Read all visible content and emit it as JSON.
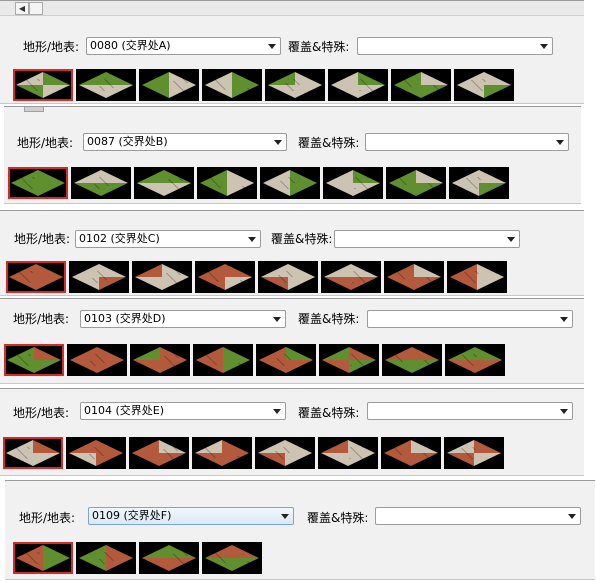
{
  "labels": {
    "terrain": "地形/地表:",
    "overlay": "覆盖&特殊:"
  },
  "colors": {
    "grass": "#5f8f2e",
    "stone": "#cdc3b3",
    "brick": "#b35a3c",
    "selected_border": "#d32a2a"
  },
  "panels": [
    {
      "terrain_value": "0080 (交界处A)",
      "overlay_value": "",
      "tiles": [
        {
          "icon": "transition-tile-icon",
          "left": "stone",
          "right": "stone",
          "top": "grass",
          "bottom": "grass",
          "selected": true
        },
        {
          "icon": "transition-tile-icon",
          "left": "grass",
          "right": "stone",
          "top": "grass",
          "bottom": "stone"
        },
        {
          "icon": "transition-tile-icon",
          "left": "grass",
          "right": "stone",
          "top": "stone",
          "bottom": "grass"
        },
        {
          "icon": "transition-tile-icon",
          "left": "stone",
          "right": "grass",
          "top": "grass",
          "bottom": "stone"
        },
        {
          "icon": "transition-tile-icon",
          "left": "grass",
          "right": "stone",
          "top": "stone",
          "bottom": "stone"
        },
        {
          "icon": "transition-tile-icon",
          "left": "stone",
          "right": "stone",
          "top": "grass",
          "bottom": "stone"
        },
        {
          "icon": "transition-tile-icon",
          "left": "grass",
          "right": "grass",
          "top": "stone",
          "bottom": "grass"
        },
        {
          "icon": "transition-tile-icon",
          "left": "stone",
          "right": "grass",
          "top": "stone",
          "bottom": "stone"
        }
      ]
    },
    {
      "terrain_value": "0087 (交界处B)",
      "overlay_value": "",
      "tiles": [
        {
          "icon": "transition-tile-icon",
          "left": "grass",
          "right": "grass",
          "top": "grass",
          "bottom": "grass",
          "selected": true
        },
        {
          "icon": "transition-tile-icon",
          "left": "stone",
          "right": "grass",
          "top": "stone",
          "bottom": "grass"
        },
        {
          "icon": "transition-tile-icon",
          "left": "grass",
          "right": "stone",
          "top": "grass",
          "bottom": "stone"
        },
        {
          "icon": "transition-tile-icon",
          "left": "grass",
          "right": "stone",
          "top": "stone",
          "bottom": "grass"
        },
        {
          "icon": "transition-tile-icon",
          "left": "stone",
          "right": "grass",
          "top": "grass",
          "bottom": "stone"
        },
        {
          "icon": "transition-tile-icon",
          "left": "stone",
          "right": "stone",
          "top": "grass",
          "bottom": "stone"
        },
        {
          "icon": "transition-tile-icon",
          "left": "grass",
          "right": "grass",
          "top": "stone",
          "bottom": "grass"
        },
        {
          "icon": "transition-tile-icon",
          "left": "stone",
          "right": "grass",
          "top": "stone",
          "bottom": "stone"
        }
      ]
    },
    {
      "terrain_value": "0102 (交界处C)",
      "overlay_value": "",
      "tiles": [
        {
          "icon": "transition-tile-icon",
          "left": "brick",
          "right": "brick",
          "top": "brick",
          "bottom": "brick",
          "selected": true
        },
        {
          "icon": "transition-tile-icon",
          "left": "stone",
          "right": "brick",
          "top": "stone",
          "bottom": "stone"
        },
        {
          "icon": "transition-tile-icon",
          "left": "brick",
          "right": "stone",
          "top": "stone",
          "bottom": "stone"
        },
        {
          "icon": "transition-tile-icon",
          "left": "brick",
          "right": "stone",
          "top": "brick",
          "bottom": "brick"
        },
        {
          "icon": "transition-tile-icon",
          "left": "stone",
          "right": "stone",
          "top": "stone",
          "bottom": "brick"
        },
        {
          "icon": "transition-tile-icon",
          "left": "stone",
          "right": "brick",
          "top": "stone",
          "bottom": "brick"
        },
        {
          "icon": "transition-tile-icon",
          "left": "brick",
          "right": "brick",
          "top": "stone",
          "bottom": "brick"
        },
        {
          "icon": "transition-tile-icon",
          "left": "brick",
          "right": "stone",
          "top": "stone",
          "bottom": "brick"
        }
      ]
    },
    {
      "terrain_value": "0103 (交界处D)",
      "overlay_value": "",
      "tiles": [
        {
          "icon": "transition-tile-icon",
          "left": "grass",
          "right": "grass",
          "top": "brick",
          "bottom": "grass",
          "selected": true
        },
        {
          "icon": "transition-tile-icon",
          "left": "brick",
          "right": "brick",
          "top": "brick",
          "bottom": "brick"
        },
        {
          "icon": "transition-tile-icon",
          "left": "grass",
          "right": "brick",
          "top": "brick",
          "bottom": "brick"
        },
        {
          "icon": "transition-tile-icon",
          "left": "brick",
          "right": "grass",
          "top": "grass",
          "bottom": "brick"
        },
        {
          "icon": "transition-tile-icon",
          "left": "brick",
          "right": "brick",
          "top": "grass",
          "bottom": "brick"
        },
        {
          "icon": "transition-tile-icon",
          "left": "grass",
          "right": "grass",
          "top": "brick",
          "bottom": "brick"
        },
        {
          "icon": "transition-tile-icon",
          "left": "brick",
          "right": "grass",
          "top": "brick",
          "bottom": "grass"
        },
        {
          "icon": "transition-tile-icon",
          "left": "grass",
          "right": "brick",
          "top": "grass",
          "bottom": "brick"
        }
      ]
    },
    {
      "terrain_value": "0104 (交界处E)",
      "overlay_value": "",
      "tiles": [
        {
          "icon": "transition-tile-icon",
          "left": "stone",
          "right": "stone",
          "top": "brick",
          "bottom": "stone",
          "selected": true
        },
        {
          "icon": "transition-tile-icon",
          "left": "brick",
          "right": "brick",
          "top": "brick",
          "bottom": "stone"
        },
        {
          "icon": "transition-tile-icon",
          "left": "brick",
          "right": "brick",
          "top": "stone",
          "bottom": "brick"
        },
        {
          "icon": "transition-tile-icon",
          "left": "stone",
          "right": "brick",
          "top": "brick",
          "bottom": "brick"
        },
        {
          "icon": "transition-tile-icon",
          "left": "stone",
          "right": "stone",
          "top": "stone",
          "bottom": "brick"
        },
        {
          "icon": "transition-tile-icon",
          "left": "brick",
          "right": "stone",
          "top": "stone",
          "bottom": "stone"
        },
        {
          "icon": "transition-tile-icon",
          "left": "brick",
          "right": "brick",
          "top": "stone",
          "bottom": "brick"
        },
        {
          "icon": "transition-tile-icon",
          "left": "stone",
          "right": "stone",
          "top": "brick",
          "bottom": "brick"
        }
      ]
    },
    {
      "terrain_value": "0109 (交界处F)",
      "overlay_value": "",
      "tiles": [
        {
          "icon": "transition-tile-icon",
          "left": "brick",
          "right": "grass",
          "top": "grass",
          "bottom": "brick",
          "selected": true
        },
        {
          "icon": "transition-tile-icon",
          "left": "grass",
          "right": "brick",
          "top": "brick",
          "bottom": "grass"
        },
        {
          "icon": "transition-tile-icon",
          "left": "grass",
          "right": "brick",
          "top": "grass",
          "bottom": "brick"
        },
        {
          "icon": "transition-tile-icon",
          "left": "brick",
          "right": "grass",
          "top": "brick",
          "bottom": "grass"
        }
      ]
    }
  ]
}
